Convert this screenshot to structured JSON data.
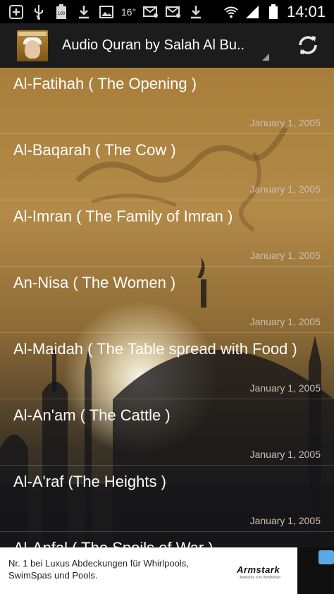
{
  "status_bar": {
    "temperature": "16°",
    "clock": "14:01",
    "battery_level": "100",
    "icons": [
      "add-icon",
      "usb-icon",
      "battery-full-icon",
      "download-icon",
      "image-icon",
      "temperature",
      "email-icon",
      "email-icon",
      "download-icon",
      "wifi-icon",
      "signal-icon",
      "battery-icon"
    ]
  },
  "action_bar": {
    "title": "Audio Quran by Salah Al Bu..",
    "refresh_icon": "refresh-icon"
  },
  "list": {
    "items": [
      {
        "title": "Al-Fatihah ( The Opening )",
        "date": "January 1, 2005"
      },
      {
        "title": "Al-Baqarah ( The Cow )",
        "date": "January 1, 2005"
      },
      {
        "title": "Al-Imran ( The Family of Imran )",
        "date": "January 1, 2005"
      },
      {
        "title": "An-Nisa ( The Women )",
        "date": "January 1, 2005"
      },
      {
        "title": "Al-Maidah ( The Table spread with Food )",
        "date": "January 1, 2005"
      },
      {
        "title": "Al-An'am ( The Cattle )",
        "date": "January 1, 2005"
      },
      {
        "title": "Al-A'raf (The Heights )",
        "date": "January 1, 2005"
      },
      {
        "title": "Al-Anfal ( The Spoils of War )",
        "date": ""
      }
    ]
  },
  "ad": {
    "text": "Nr. 1 bei Luxus Abdeckungen für Whirlpools, SwimSpas und Pools.",
    "brand": "Armstark",
    "brand_sub": "Ambiente zum Wohlfühlen"
  },
  "colors": {
    "action_bar": "#1c1c1c",
    "text_primary": "#ffffff",
    "text_date": "#c9c0b4"
  }
}
